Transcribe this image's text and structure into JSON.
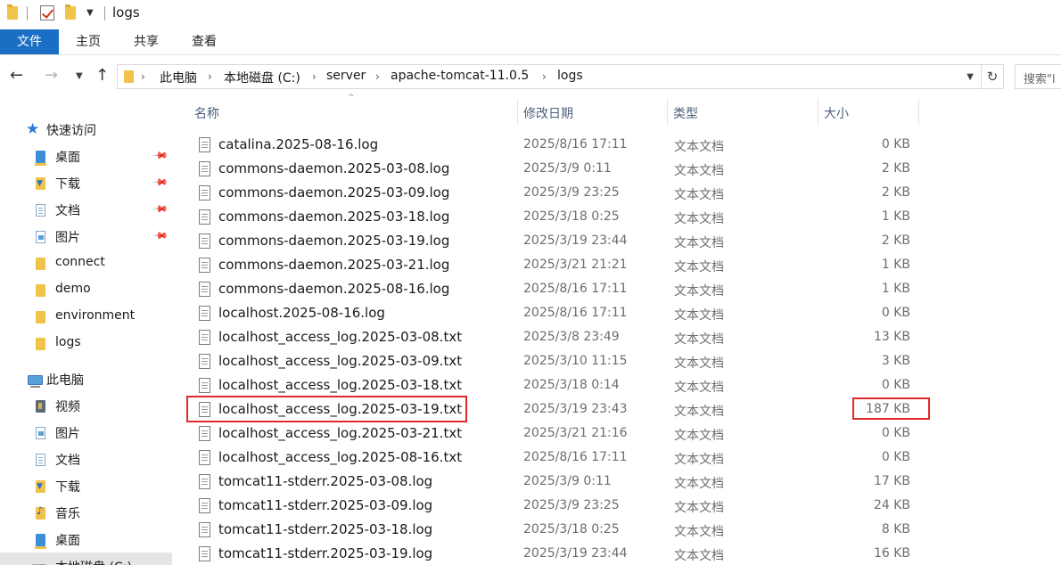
{
  "window": {
    "title": "logs"
  },
  "ribbon": {
    "tabs": [
      "文件",
      "主页",
      "共享",
      "查看"
    ]
  },
  "address": {
    "crumbs": [
      "此电脑",
      "本地磁盘 (C:)",
      "server",
      "apache-tomcat-11.0.5",
      "logs"
    ],
    "search_placeholder": "搜索\"l"
  },
  "navpane": {
    "quick_access": "快速访问",
    "quick_items": [
      {
        "label": "桌面",
        "icon": "desktop-icon",
        "pinned": true
      },
      {
        "label": "下载",
        "icon": "downloads-icon",
        "pinned": true
      },
      {
        "label": "文档",
        "icon": "documents-icon",
        "pinned": true
      },
      {
        "label": "图片",
        "icon": "pictures-icon",
        "pinned": true
      },
      {
        "label": "connect",
        "icon": "folder-icon",
        "pinned": false
      },
      {
        "label": "demo",
        "icon": "folder-icon",
        "pinned": false
      },
      {
        "label": "environment",
        "icon": "folder-icon",
        "pinned": false
      },
      {
        "label": "logs",
        "icon": "folder-icon",
        "pinned": false
      }
    ],
    "this_pc": "此电脑",
    "pc_items": [
      {
        "label": "视频",
        "icon": "videos-icon"
      },
      {
        "label": "图片",
        "icon": "pictures-icon"
      },
      {
        "label": "文档",
        "icon": "documents-icon"
      },
      {
        "label": "下载",
        "icon": "downloads-icon"
      },
      {
        "label": "音乐",
        "icon": "music-icon"
      },
      {
        "label": "桌面",
        "icon": "desktop-icon"
      },
      {
        "label": "本地磁盘 (C:)",
        "icon": "drive-icon"
      }
    ]
  },
  "columns": {
    "name": "名称",
    "date": "修改日期",
    "type": "类型",
    "size": "大小"
  },
  "files": [
    {
      "name": "catalina.2025-08-16.log",
      "date": "2025/8/16 17:11",
      "type": "文本文档",
      "size": "0 KB"
    },
    {
      "name": "commons-daemon.2025-03-08.log",
      "date": "2025/3/9 0:11",
      "type": "文本文档",
      "size": "2 KB"
    },
    {
      "name": "commons-daemon.2025-03-09.log",
      "date": "2025/3/9 23:25",
      "type": "文本文档",
      "size": "2 KB"
    },
    {
      "name": "commons-daemon.2025-03-18.log",
      "date": "2025/3/18 0:25",
      "type": "文本文档",
      "size": "1 KB"
    },
    {
      "name": "commons-daemon.2025-03-19.log",
      "date": "2025/3/19 23:44",
      "type": "文本文档",
      "size": "2 KB"
    },
    {
      "name": "commons-daemon.2025-03-21.log",
      "date": "2025/3/21 21:21",
      "type": "文本文档",
      "size": "1 KB"
    },
    {
      "name": "commons-daemon.2025-08-16.log",
      "date": "2025/8/16 17:11",
      "type": "文本文档",
      "size": "1 KB"
    },
    {
      "name": "localhost.2025-08-16.log",
      "date": "2025/8/16 17:11",
      "type": "文本文档",
      "size": "0 KB"
    },
    {
      "name": "localhost_access_log.2025-03-08.txt",
      "date": "2025/3/8 23:49",
      "type": "文本文档",
      "size": "13 KB"
    },
    {
      "name": "localhost_access_log.2025-03-09.txt",
      "date": "2025/3/10 11:15",
      "type": "文本文档",
      "size": "3 KB"
    },
    {
      "name": "localhost_access_log.2025-03-18.txt",
      "date": "2025/3/18 0:14",
      "type": "文本文档",
      "size": "0 KB"
    },
    {
      "name": "localhost_access_log.2025-03-19.txt",
      "date": "2025/3/19 23:43",
      "type": "文本文档",
      "size": "187 KB"
    },
    {
      "name": "localhost_access_log.2025-03-21.txt",
      "date": "2025/3/21 21:16",
      "type": "文本文档",
      "size": "0 KB"
    },
    {
      "name": "localhost_access_log.2025-08-16.txt",
      "date": "2025/8/16 17:11",
      "type": "文本文档",
      "size": "0 KB"
    },
    {
      "name": "tomcat11-stderr.2025-03-08.log",
      "date": "2025/3/9 0:11",
      "type": "文本文档",
      "size": "17 KB"
    },
    {
      "name": "tomcat11-stderr.2025-03-09.log",
      "date": "2025/3/9 23:25",
      "type": "文本文档",
      "size": "24 KB"
    },
    {
      "name": "tomcat11-stderr.2025-03-18.log",
      "date": "2025/3/18 0:25",
      "type": "文本文档",
      "size": "8 KB"
    },
    {
      "name": "tomcat11-stderr.2025-03-19.log",
      "date": "2025/3/19 23:44",
      "type": "文本文档",
      "size": "16 KB"
    }
  ],
  "colors": {
    "accent": "#1a6fc4",
    "highlight": "#e02a2a",
    "folder": "#f2c34b"
  }
}
